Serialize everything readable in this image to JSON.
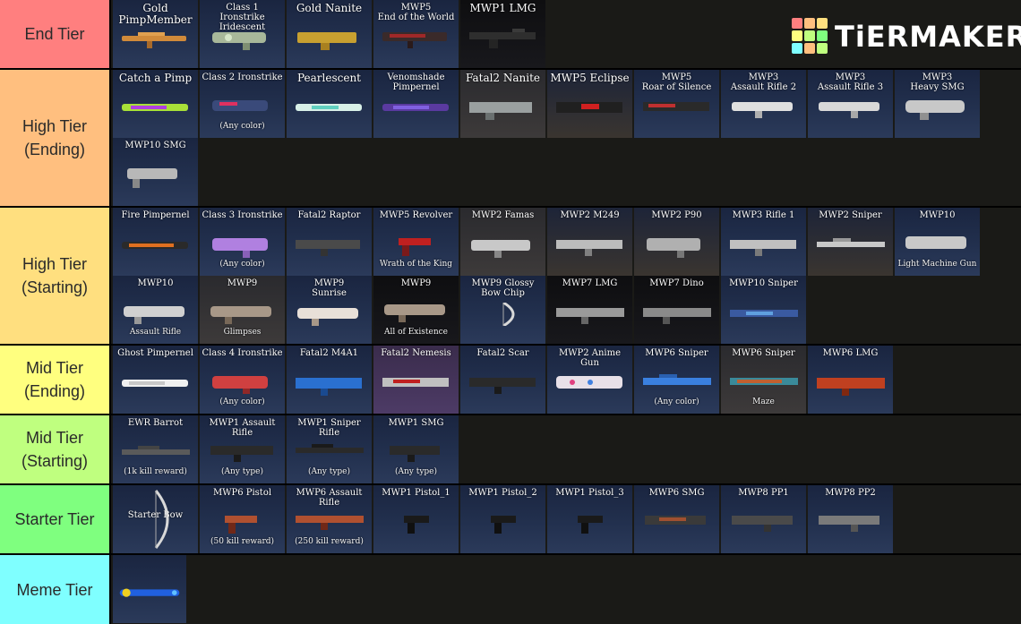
{
  "logo": {
    "text": "TiERMAKER"
  },
  "colors": {
    "end": "#ff7f7f",
    "high_end": "#ffbf7f",
    "high_start": "#ffdf7f",
    "mid_end": "#ffff7f",
    "mid_start": "#bfff7f",
    "starter": "#7fff7f",
    "meme": "#7fffff"
  },
  "tiers": [
    {
      "label": "End Tier",
      "items": [
        {
          "name": "Gold PimpMember",
          "note": ""
        },
        {
          "name": "Class 1\nIronstrike Iridescent",
          "note": ""
        },
        {
          "name": "Gold Nanite",
          "note": ""
        },
        {
          "name": "MWP5\nEnd of the World",
          "note": ""
        },
        {
          "name": "MWP1 LMG",
          "note": ""
        }
      ]
    },
    {
      "label": "High Tier\n(Ending)",
      "items": [
        {
          "name": "Catch a Pimp",
          "note": ""
        },
        {
          "name": "Class 2 Ironstrike",
          "note": "(Any color)"
        },
        {
          "name": "Pearlescent",
          "note": ""
        },
        {
          "name": "Venomshade\nPimpernel",
          "note": ""
        },
        {
          "name": "Fatal2 Nanite",
          "note": ""
        },
        {
          "name": "MWP5 Eclipse",
          "note": ""
        },
        {
          "name": "MWP5\nRoar of Silence",
          "note": ""
        },
        {
          "name": "MWP3\nAssault Rifle 2",
          "note": ""
        },
        {
          "name": "MWP3\nAssault Rifle 3",
          "note": ""
        },
        {
          "name": "MWP3\nHeavy SMG",
          "note": ""
        },
        {
          "name": "MWP10 SMG",
          "note": ""
        }
      ]
    },
    {
      "label": "High Tier\n(Starting)",
      "items": [
        {
          "name": "Fire Pimpernel",
          "note": ""
        },
        {
          "name": "Class 3 Ironstrike",
          "note": "(Any color)"
        },
        {
          "name": "Fatal2 Raptor",
          "note": ""
        },
        {
          "name": "MWP5 Revolver",
          "note": "Wrath of the King"
        },
        {
          "name": "MWP2 Famas",
          "note": ""
        },
        {
          "name": "MWP2 M249",
          "note": ""
        },
        {
          "name": "MWP2 P90",
          "note": ""
        },
        {
          "name": "MWP3 Rifle 1",
          "note": ""
        },
        {
          "name": "MWP2 Sniper",
          "note": ""
        },
        {
          "name": "MWP10",
          "note": "Light Machine Gun"
        },
        {
          "name": "MWP10",
          "note": "Assault Rifle"
        },
        {
          "name": "MWP9",
          "note": "Glimpses"
        },
        {
          "name": "MWP9\nSunrise",
          "note": ""
        },
        {
          "name": "MWP9",
          "note": "All of Existence"
        },
        {
          "name": "MWP9  Glossy\nBow     Chip",
          "note": ""
        },
        {
          "name": "MWP7 LMG",
          "note": ""
        },
        {
          "name": "MWP7 Dino",
          "note": ""
        },
        {
          "name": "MWP10 Sniper",
          "note": ""
        }
      ]
    },
    {
      "label": "Mid Tier\n(Ending)",
      "items": [
        {
          "name": "Ghost Pimpernel",
          "note": ""
        },
        {
          "name": "Class 4 Ironstrike",
          "note": "(Any color)"
        },
        {
          "name": "Fatal2 M4A1",
          "note": ""
        },
        {
          "name": "Fatal2 Nemesis",
          "note": ""
        },
        {
          "name": "Fatal2 Scar",
          "note": ""
        },
        {
          "name": "MWP2 Anime Gun",
          "note": ""
        },
        {
          "name": "MWP6 Sniper",
          "note": "(Any color)"
        },
        {
          "name": "MWP6 Sniper",
          "note": "Maze"
        },
        {
          "name": "MWP6 LMG",
          "note": ""
        }
      ]
    },
    {
      "label": "Mid Tier\n(Starting)",
      "items": [
        {
          "name": "EWR Barrot",
          "note": "(1k kill reward)"
        },
        {
          "name": "MWP1 Assault Rifle",
          "note": "(Any type)"
        },
        {
          "name": "MWP1 Sniper Rifle",
          "note": "(Any type)"
        },
        {
          "name": "MWP1 SMG",
          "note": "(Any type)"
        }
      ]
    },
    {
      "label": "Starter Tier",
      "items": [
        {
          "name": "Starter      Bow",
          "note": ""
        },
        {
          "name": "MWP6 Pistol",
          "note": "(50 kill reward)"
        },
        {
          "name": "MWP6 Assault Rifle",
          "note": "(250 kill reward)"
        },
        {
          "name": "MWP1 Pistol_1",
          "note": ""
        },
        {
          "name": "MWP1 Pistol_2",
          "note": ""
        },
        {
          "name": "MWP1 Pistol_3",
          "note": ""
        },
        {
          "name": "MWP6 SMG",
          "note": ""
        },
        {
          "name": "MWP8 PP1",
          "note": ""
        },
        {
          "name": "MWP8 PP2",
          "note": ""
        }
      ]
    },
    {
      "label": "Meme Tier",
      "items": [
        {
          "name": "",
          "note": ""
        }
      ]
    }
  ]
}
